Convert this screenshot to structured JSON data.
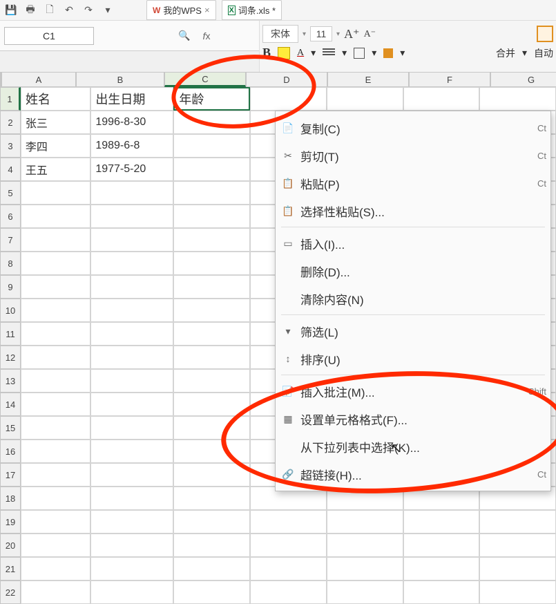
{
  "tabs": {
    "wps": {
      "logo": "W",
      "title": "我的WPS"
    },
    "file": {
      "icon": "X",
      "title": "词条.xls *"
    }
  },
  "namebox": "C1",
  "ribbon": {
    "font_name": "宋体",
    "font_size": "11",
    "increase_font": "A⁺",
    "decrease_font": "A⁻",
    "bold": "B",
    "font_color_label": "A",
    "merge_label": "合并",
    "auto_label": "自动"
  },
  "columns": [
    "A",
    "B",
    "C",
    "D",
    "E",
    "F",
    "G"
  ],
  "rows": [
    {
      "n": "1",
      "A": "姓名",
      "B": "出生日期",
      "C": "年龄"
    },
    {
      "n": "2",
      "A": "张三",
      "B": "1996-8-30",
      "C": ""
    },
    {
      "n": "3",
      "A": "李四",
      "B": "1989-6-8",
      "C": ""
    },
    {
      "n": "4",
      "A": "王五",
      "B": "1977-5-20",
      "C": ""
    },
    {
      "n": "5"
    },
    {
      "n": "6"
    },
    {
      "n": "7"
    },
    {
      "n": "8"
    },
    {
      "n": "9"
    },
    {
      "n": "10"
    },
    {
      "n": "11"
    },
    {
      "n": "12"
    },
    {
      "n": "13"
    },
    {
      "n": "14"
    },
    {
      "n": "15"
    },
    {
      "n": "16"
    },
    {
      "n": "17"
    },
    {
      "n": "18"
    },
    {
      "n": "19"
    },
    {
      "n": "20"
    },
    {
      "n": "21"
    },
    {
      "n": "22"
    }
  ],
  "context_menu": {
    "copy": {
      "label": "复制(C)",
      "shortcut": "Ct"
    },
    "cut": {
      "label": "剪切(T)",
      "shortcut": "Ct"
    },
    "paste": {
      "label": "粘贴(P)",
      "shortcut": "Ct"
    },
    "paste_special": {
      "label": "选择性粘贴(S)..."
    },
    "insert": {
      "label": "插入(I)..."
    },
    "delete": {
      "label": "删除(D)..."
    },
    "clear": {
      "label": "清除内容(N)"
    },
    "filter": {
      "label": "筛选(L)"
    },
    "sort": {
      "label": "排序(U)"
    },
    "comment": {
      "label": "插入批注(M)...",
      "shortcut": "Shift"
    },
    "format": {
      "label": "设置单元格格式(F)..."
    },
    "picklist": {
      "label": "从下拉列表中选择(K)..."
    },
    "hyperlink": {
      "label": "超链接(H)...",
      "shortcut": "Ct"
    }
  }
}
